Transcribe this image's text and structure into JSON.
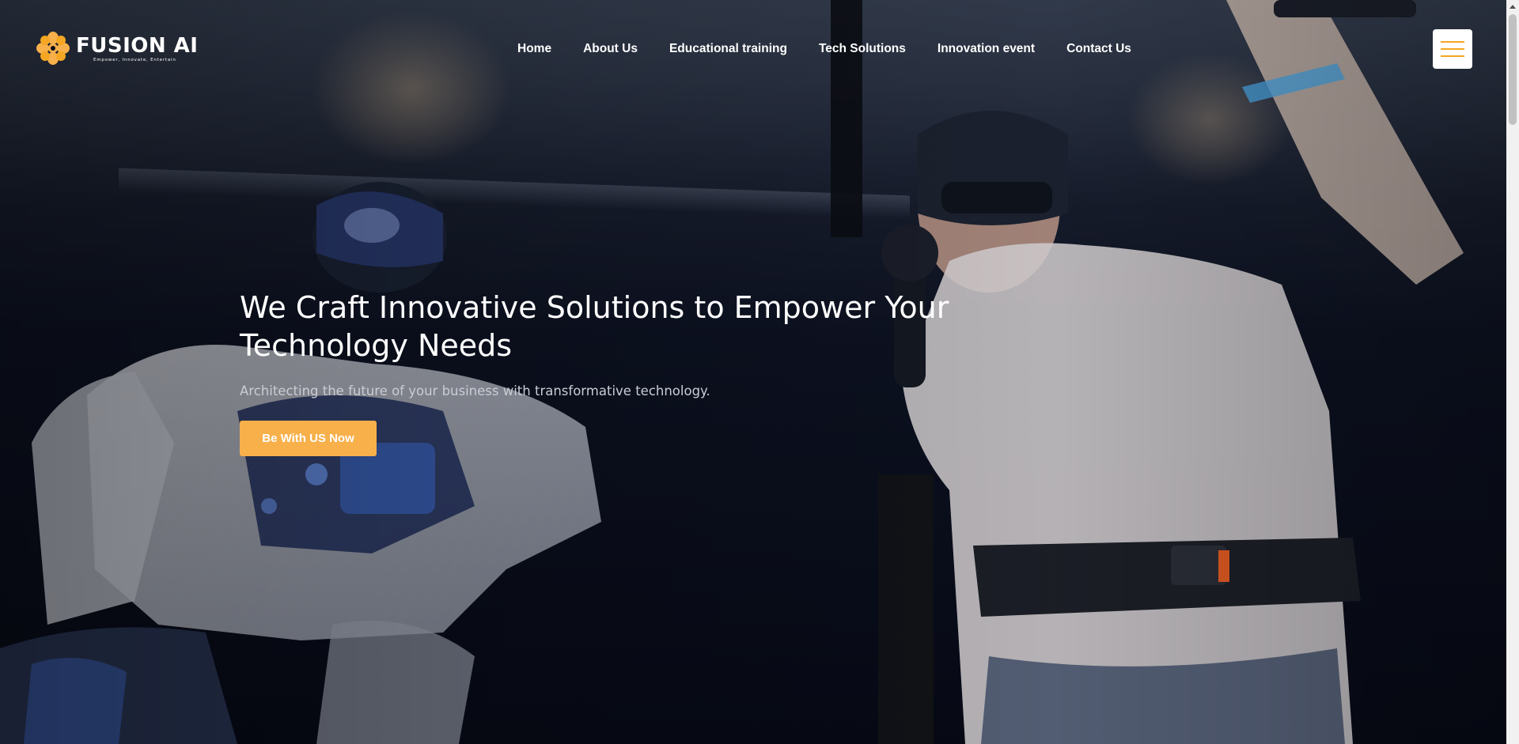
{
  "brand": {
    "name": "FUSION AI",
    "tagline": "Empower, Innovate, Entertain",
    "accent_color": "#f7b04a"
  },
  "nav": {
    "items": [
      {
        "label": "Home"
      },
      {
        "label": "About Us"
      },
      {
        "label": "Educational training"
      },
      {
        "label": "Tech Solutions"
      },
      {
        "label": "Innovation event"
      },
      {
        "label": "Contact Us"
      }
    ],
    "menu_icon": "hamburger-icon"
  },
  "hero": {
    "headline": "We Craft Innovative Solutions to Empower Your Technology Needs",
    "subheadline": "Architecting the future of your business with transformative technology.",
    "cta_label": "Be With US Now",
    "background_image": "robot and person wearing VR headset"
  }
}
